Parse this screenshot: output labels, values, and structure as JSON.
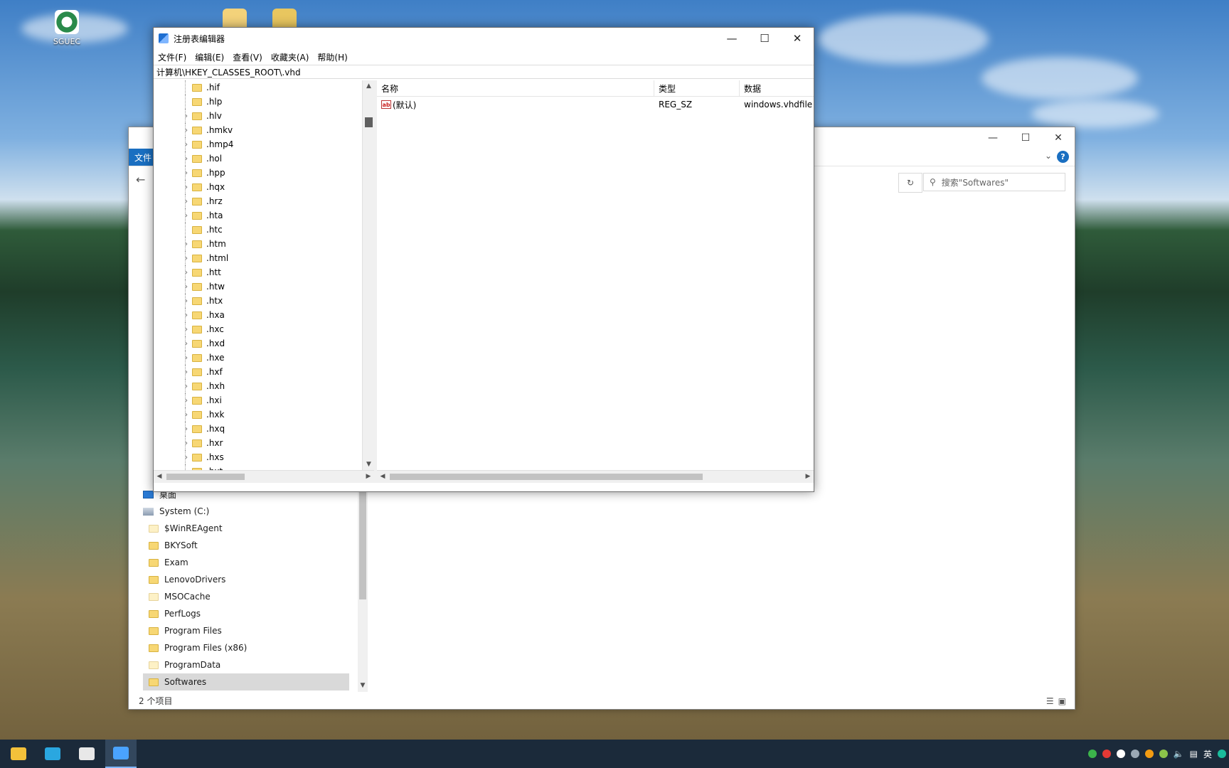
{
  "desktop": {
    "icons": [
      {
        "label": "SGUEC"
      }
    ]
  },
  "explorer": {
    "file_tab": "文件",
    "search_placeholder": "搜索\"Softwares\"",
    "help_label": "?",
    "tree": [
      {
        "label": "桌面",
        "icon": "desktop-icon"
      },
      {
        "label": "System (C:)",
        "icon": "drive-icon"
      },
      {
        "label": "$WinREAgent",
        "icon": "folder-icon"
      },
      {
        "label": "BKYSoft",
        "icon": "folder-icon"
      },
      {
        "label": "Exam",
        "icon": "folder-icon"
      },
      {
        "label": "LenovoDrivers",
        "icon": "folder-icon"
      },
      {
        "label": "MSOCache",
        "icon": "folder-icon"
      },
      {
        "label": "PerfLogs",
        "icon": "folder-icon"
      },
      {
        "label": "Program Files",
        "icon": "folder-icon"
      },
      {
        "label": "Program Files (x86)",
        "icon": "folder-icon"
      },
      {
        "label": "ProgramData",
        "icon": "folder-icon"
      },
      {
        "label": "Softwares",
        "icon": "folder-icon",
        "selected": true
      }
    ],
    "status": "2 个项目"
  },
  "regedit": {
    "title": "注册表编辑器",
    "menu": [
      "文件(F)",
      "编辑(E)",
      "查看(V)",
      "收藏夹(A)",
      "帮助(H)"
    ],
    "address": "计算机\\HKEY_CLASSES_ROOT\\.vhd",
    "tree": [
      {
        "label": ".hif",
        "expandable": false
      },
      {
        "label": ".hlp",
        "expandable": false
      },
      {
        "label": ".hlv",
        "expandable": true
      },
      {
        "label": ".hmkv",
        "expandable": true
      },
      {
        "label": ".hmp4",
        "expandable": true
      },
      {
        "label": ".hol",
        "expandable": true
      },
      {
        "label": ".hpp",
        "expandable": true
      },
      {
        "label": ".hqx",
        "expandable": true
      },
      {
        "label": ".hrz",
        "expandable": true
      },
      {
        "label": ".hta",
        "expandable": true
      },
      {
        "label": ".htc",
        "expandable": false
      },
      {
        "label": ".htm",
        "expandable": true
      },
      {
        "label": ".html",
        "expandable": true
      },
      {
        "label": ".htt",
        "expandable": true
      },
      {
        "label": ".htw",
        "expandable": true
      },
      {
        "label": ".htx",
        "expandable": true
      },
      {
        "label": ".hxa",
        "expandable": true
      },
      {
        "label": ".hxc",
        "expandable": true
      },
      {
        "label": ".hxd",
        "expandable": true
      },
      {
        "label": ".hxe",
        "expandable": true
      },
      {
        "label": ".hxf",
        "expandable": true
      },
      {
        "label": ".hxh",
        "expandable": true
      },
      {
        "label": ".hxi",
        "expandable": true
      },
      {
        "label": ".hxk",
        "expandable": true
      },
      {
        "label": ".hxq",
        "expandable": true
      },
      {
        "label": ".hxr",
        "expandable": true
      },
      {
        "label": ".hxs",
        "expandable": true
      },
      {
        "label": ".hxt",
        "expandable": true
      }
    ],
    "columns": {
      "name": "名称",
      "type": "类型",
      "data": "数据"
    },
    "values": [
      {
        "name": "(默认)",
        "type": "REG_SZ",
        "data": "windows.vhdfile",
        "icon": "ab-icon"
      }
    ]
  },
  "taskbar": {
    "apps": [
      {
        "name": "file-explorer-icon",
        "color": "#f3c13a"
      },
      {
        "name": "search-app-icon",
        "color": "#2aa7e0"
      },
      {
        "name": "media-app-icon",
        "color": "#e8e8e8"
      },
      {
        "name": "regedit-app-icon",
        "color": "#4aa3ff",
        "active": true
      }
    ],
    "tray": {
      "ime": "英"
    }
  }
}
